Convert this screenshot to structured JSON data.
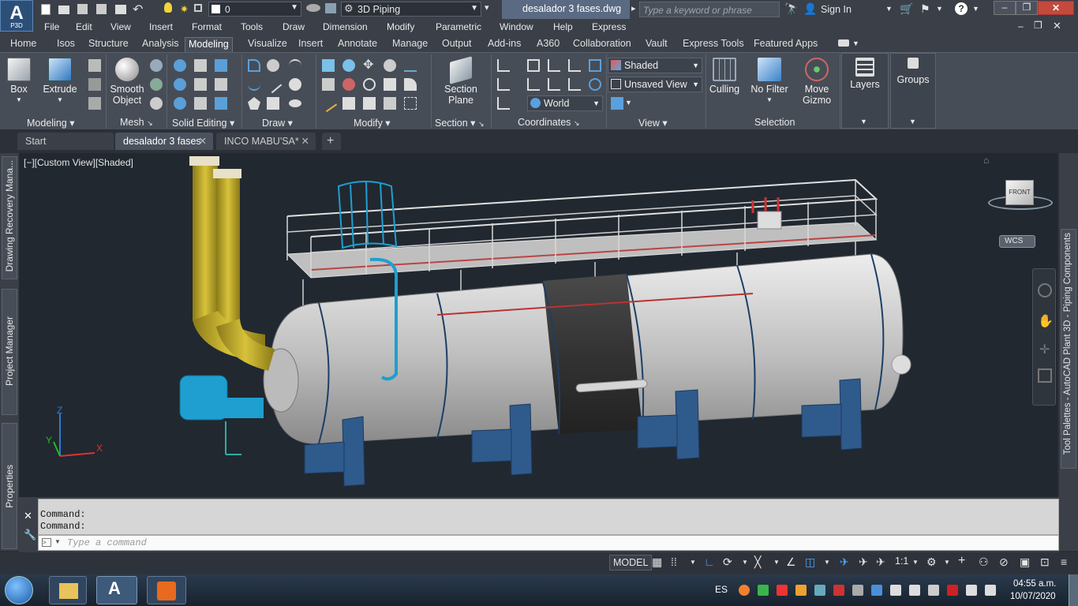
{
  "app": {
    "logo": "A",
    "logo_sub": "P3D",
    "workspace": "3D Piping",
    "doc_title": "desalador 3 fases.dwg",
    "layer_value": "0",
    "search_placeholder": "Type a keyword or phrase",
    "sign_in": "Sign In"
  },
  "menu": [
    "File",
    "Edit",
    "View",
    "Insert",
    "Format",
    "Tools",
    "Draw",
    "Dimension",
    "Modify",
    "Parametric",
    "Window",
    "Help",
    "Express"
  ],
  "ribbon_tabs": [
    "Home",
    "Isos",
    "Structure",
    "Analysis",
    "Modeling",
    "Visualize",
    "Insert",
    "Annotate",
    "Manage",
    "Output",
    "Add-ins",
    "A360",
    "Collaboration",
    "Vault",
    "Express Tools",
    "Featured Apps"
  ],
  "active_tab": "Modeling",
  "ribbon": {
    "box": "Box",
    "extrude": "Extrude",
    "smooth1": "Smooth",
    "smooth2": "Object",
    "section1": "Section",
    "section2": "Plane",
    "culling": "Culling",
    "nofilter": "No Filter",
    "move1": "Move",
    "move2": "Gizmo",
    "layers": "Layers",
    "groups": "Groups",
    "visual_style": "Shaded",
    "view": "Unsaved View",
    "ucs": "World",
    "panels": [
      "Modeling",
      "Mesh",
      "Solid Editing",
      "Draw",
      "Modify",
      "Section",
      "Coordinates",
      "View",
      "Selection"
    ]
  },
  "doc_tabs": [
    "Start",
    "desalador 3 fases",
    "INCO MABU'SA*"
  ],
  "viewport": {
    "label": "[−][Custom View][Shaded]",
    "viewcube": "FRONT",
    "wcs": "WCS"
  },
  "left_palettes": [
    "Drawing Recovery Mana...",
    "Project Manager",
    "Properties"
  ],
  "right_palette": "Tool Palettes - AutoCAD Plant 3D - Piping Components",
  "command": {
    "history": [
      "Command:",
      "Command:"
    ],
    "placeholder": "Type a command"
  },
  "status": {
    "model": "MODEL",
    "scale": "1:1"
  },
  "taskbar": {
    "lang": "ES",
    "time": "04:55 a.m.",
    "date": "10/07/2020"
  },
  "colors": {
    "accent": "#2e7bd1",
    "vessel": "#c8c8c8",
    "stack": "#c9b02a",
    "support": "#2f5a8c",
    "ladder": "#1e9fd0"
  }
}
